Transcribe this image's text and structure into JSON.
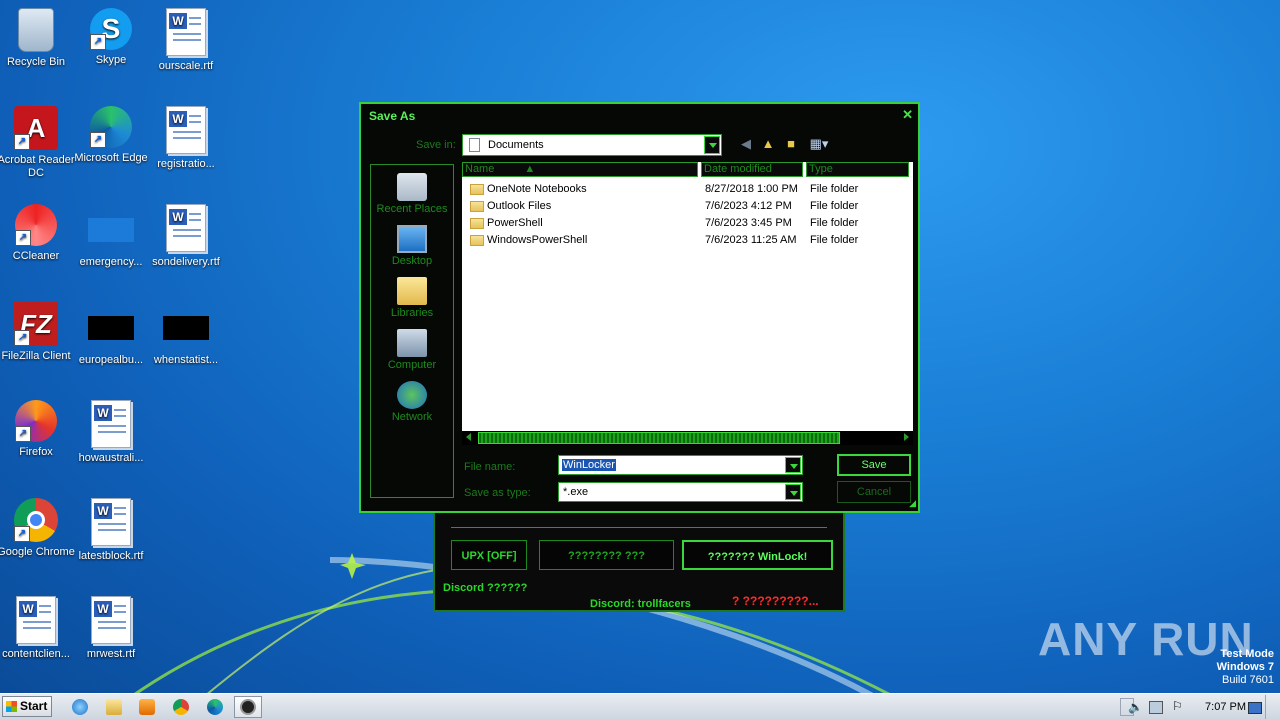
{
  "desktop": {
    "icons": [
      {
        "label": "Recycle Bin",
        "icon": "recycle-bin-icon"
      },
      {
        "label": "Skype",
        "icon": "skype-icon"
      },
      {
        "label": "ourscale.rtf",
        "icon": "word-document-icon"
      },
      {
        "label": "Acrobat Reader DC",
        "icon": "acrobat-icon"
      },
      {
        "label": "Microsoft Edge",
        "icon": "edge-icon"
      },
      {
        "label": "registratio...",
        "icon": "word-document-icon"
      },
      {
        "label": "CCleaner",
        "icon": "ccleaner-icon"
      },
      {
        "label": "emergency...",
        "icon": "file-icon"
      },
      {
        "label": "sondelivery.rtf",
        "icon": "word-document-icon"
      },
      {
        "label": "FileZilla Client",
        "icon": "filezilla-icon"
      },
      {
        "label": "europealbu...",
        "icon": "file-icon"
      },
      {
        "label": "whenstatist...",
        "icon": "file-icon"
      },
      {
        "label": "Firefox",
        "icon": "firefox-icon"
      },
      {
        "label": "howaustrali...",
        "icon": "word-document-icon"
      },
      {
        "label": "Google Chrome",
        "icon": "chrome-icon"
      },
      {
        "label": "latestblock.rtf",
        "icon": "word-document-icon"
      },
      {
        "label": "contentclien...",
        "icon": "word-document-icon"
      },
      {
        "label": "mrwest.rtf",
        "icon": "word-document-icon"
      }
    ]
  },
  "watermark": {
    "text": "ANY RUN",
    "mode_line1": "Test Mode",
    "mode_line2": "Windows 7",
    "mode_line3": "Build 7601"
  },
  "winlock_window": {
    "upx_button": "UPX [OFF]",
    "middle_button": "???????? ???",
    "main_button": "??????? WinLock!",
    "discord_left": "Discord ??????",
    "discord_center": "Discord: trollfacers",
    "status_text": "? ?????????..."
  },
  "save_dialog": {
    "title": "Save As",
    "save_in_label": "Save in:",
    "save_in_value": "Documents",
    "places": [
      {
        "label": "Recent Places"
      },
      {
        "label": "Desktop"
      },
      {
        "label": "Libraries"
      },
      {
        "label": "Computer"
      },
      {
        "label": "Network"
      }
    ],
    "columns": [
      "Name",
      "Date modified",
      "Type"
    ],
    "files": [
      {
        "name": "OneNote Notebooks",
        "date": "8/27/2018 1:00 PM",
        "type": "File folder"
      },
      {
        "name": "Outlook Files",
        "date": "7/6/2023 4:12 PM",
        "type": "File folder"
      },
      {
        "name": "PowerShell",
        "date": "7/6/2023 3:45 PM",
        "type": "File folder"
      },
      {
        "name": "WindowsPowerShell",
        "date": "7/6/2023 11:25 AM",
        "type": "File folder"
      }
    ],
    "file_name_label": "File name:",
    "file_name_value": "WinLocker",
    "save_type_label": "Save as type:",
    "save_type_value": "*.exe",
    "save_button": "Save",
    "cancel_button": "Cancel"
  },
  "taskbar": {
    "start_label": "Start",
    "clock": "7:07 PM"
  }
}
